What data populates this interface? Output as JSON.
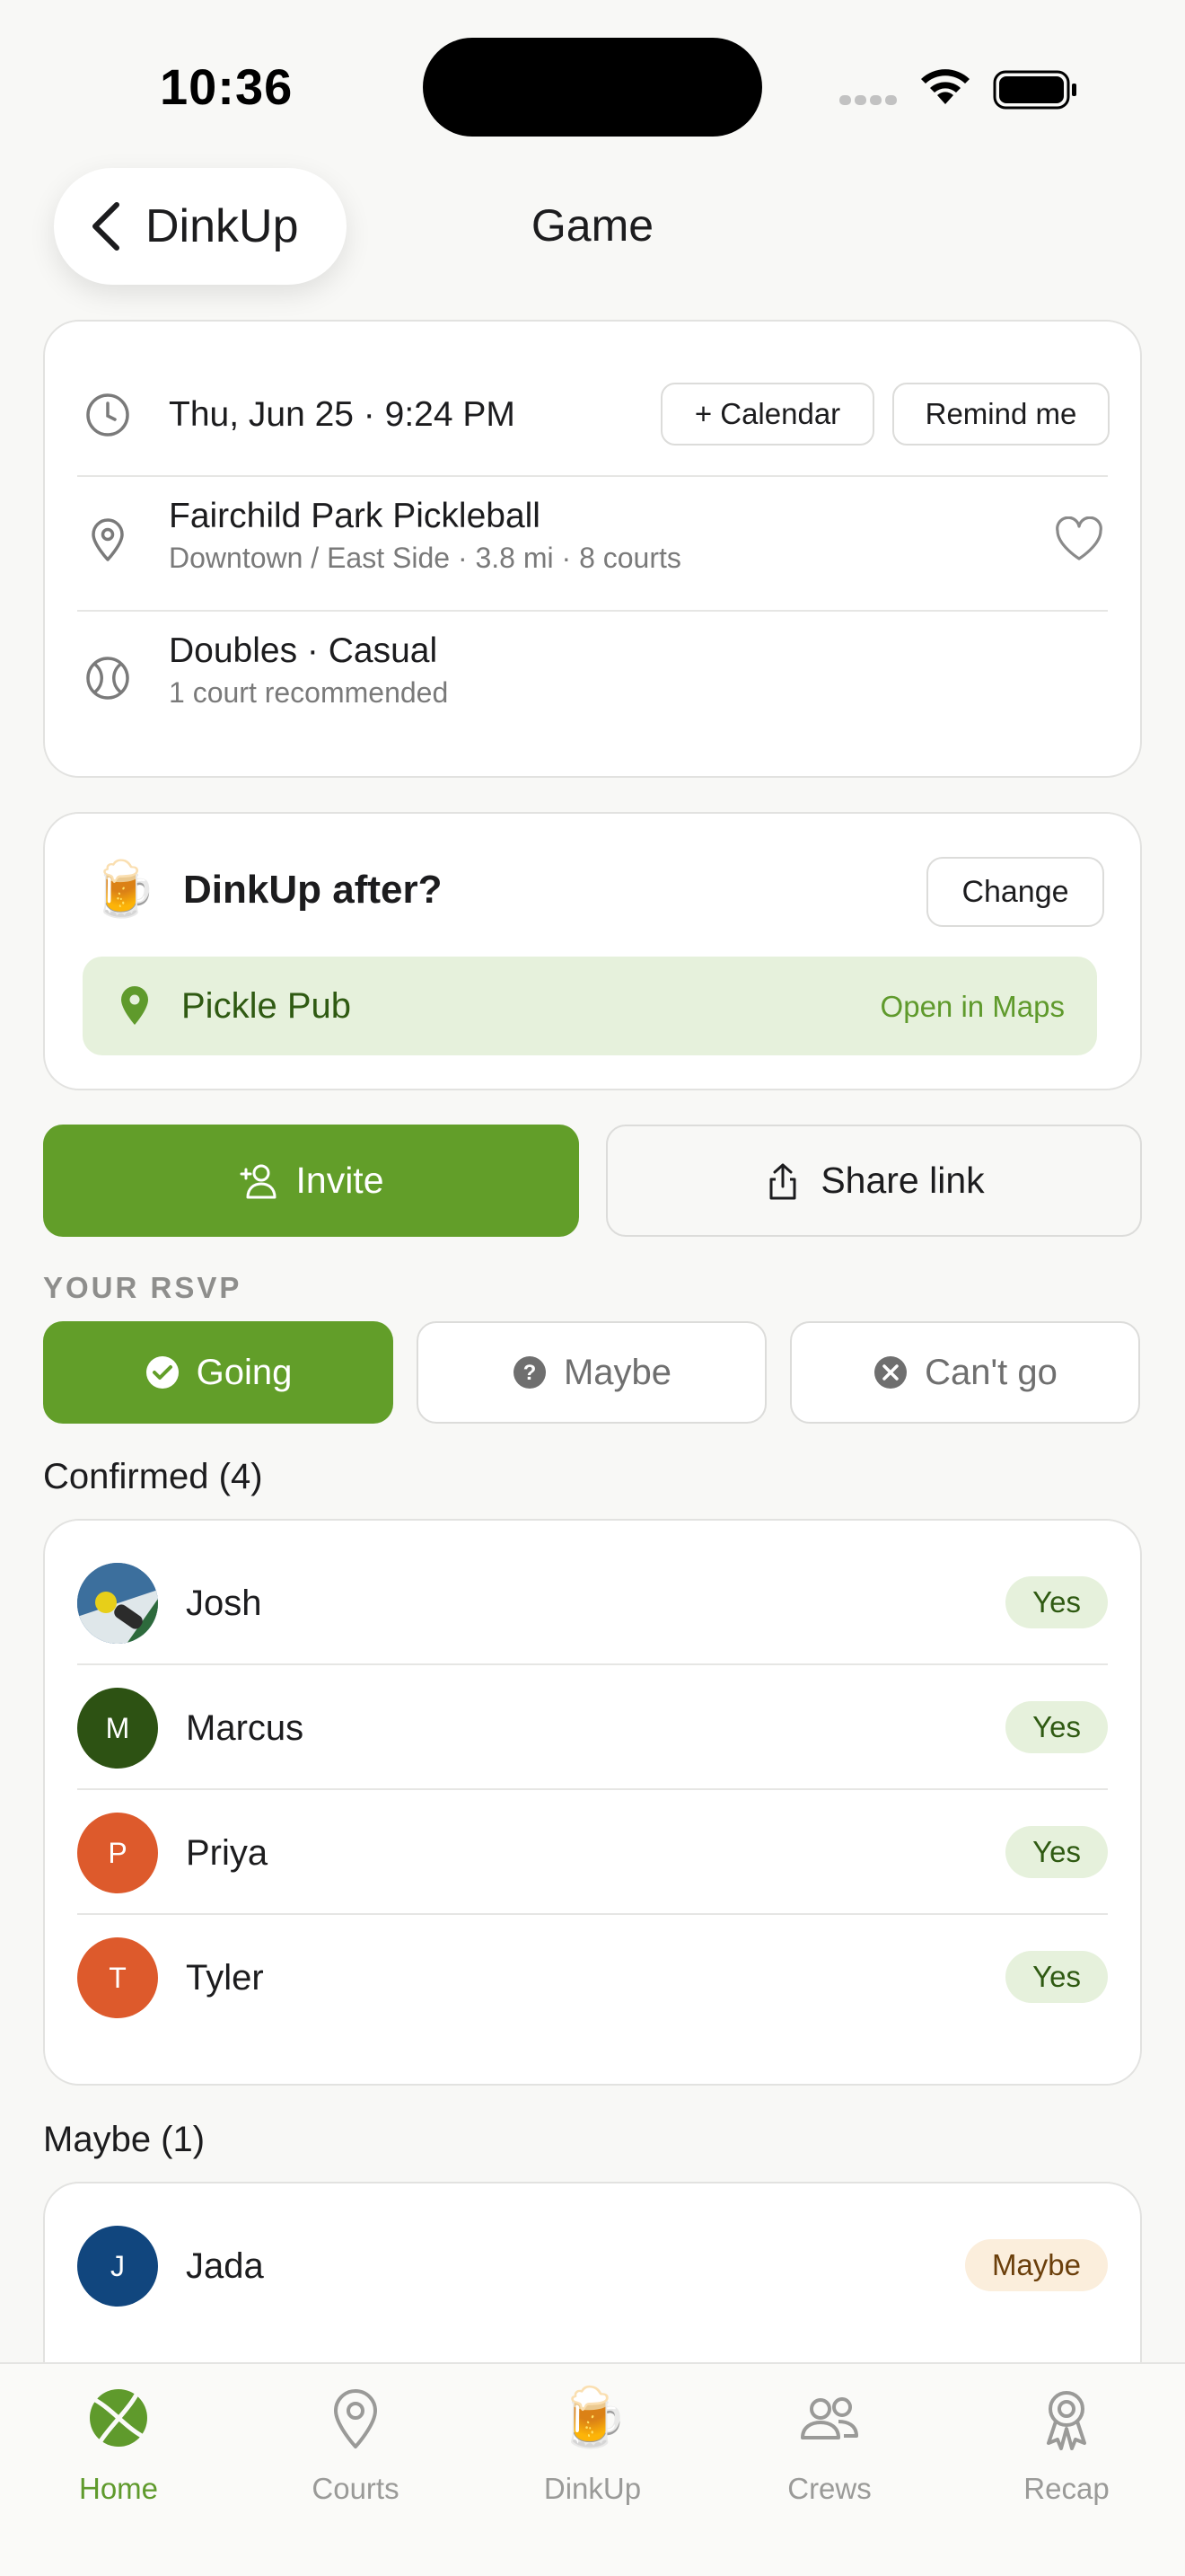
{
  "status_bar": {
    "time": "10:36"
  },
  "nav": {
    "back_label": "DinkUp",
    "title": "Game"
  },
  "info": {
    "datetime": "Thu, Jun 25 · 9:24 PM",
    "calendar_button": "+ Calendar",
    "remind_button": "Remind me",
    "venue_name": "Fairchild Park Pickleball",
    "venue_details": "Downtown / East Side · 3.8 mi · 8 courts",
    "format": "Doubles · Casual",
    "format_sub": "1 court recommended"
  },
  "dinkup": {
    "title": "DinkUp after?",
    "change_button": "Change",
    "place": "Pickle Pub",
    "maps_link": "Open in Maps"
  },
  "actions": {
    "invite": "Invite",
    "share": "Share link"
  },
  "rsvp": {
    "section_label": "YOUR RSVP",
    "going": "Going",
    "maybe": "Maybe",
    "cant": "Can't go",
    "selected": "Going"
  },
  "confirmed": {
    "label": "Confirmed (4)",
    "people": [
      {
        "name": "Josh",
        "initial": "",
        "status": "Yes",
        "color": "#3a6b98"
      },
      {
        "name": "Marcus",
        "initial": "M",
        "status": "Yes",
        "color": "#2d5213"
      },
      {
        "name": "Priya",
        "initial": "P",
        "status": "Yes",
        "color": "#dd5a2c"
      },
      {
        "name": "Tyler",
        "initial": "T",
        "status": "Yes",
        "color": "#dd5a2c"
      }
    ]
  },
  "maybe": {
    "label": "Maybe (1)",
    "people": [
      {
        "name": "Jada",
        "initial": "J",
        "status": "Maybe",
        "color": "#11467e"
      }
    ]
  },
  "tabs": [
    {
      "label": "Home",
      "icon": "tennis-ball-icon",
      "active": true
    },
    {
      "label": "Courts",
      "icon": "location-pin-icon",
      "active": false
    },
    {
      "label": "DinkUp",
      "icon": "beer-mug-icon",
      "active": false
    },
    {
      "label": "Crews",
      "icon": "people-icon",
      "active": false
    },
    {
      "label": "Recap",
      "icon": "award-icon",
      "active": false
    }
  ],
  "colors": {
    "accent": "#629e29",
    "accent_light": "#e6f1dc",
    "maybe_bg": "#fbeedc"
  }
}
